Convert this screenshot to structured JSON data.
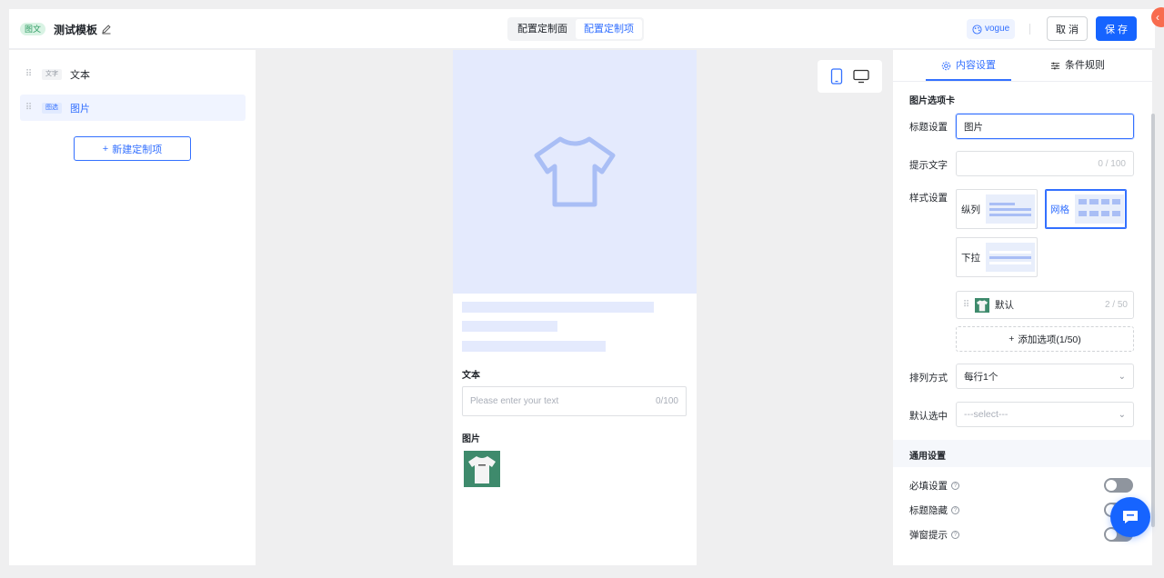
{
  "header": {
    "type_tag": "图文",
    "title": "测试模板",
    "segments": [
      "配置定制面",
      "配置定制项"
    ],
    "active_segment": "配置定制项",
    "theme": "vogue",
    "cancel_label": "取 消",
    "save_label": "保 存"
  },
  "sidebar": {
    "items": [
      {
        "tag": "文字",
        "label": "文本",
        "selected": false
      },
      {
        "tag": "图选",
        "label": "图片",
        "selected": true
      }
    ],
    "new_button": "新建定制项"
  },
  "preview": {
    "text_label": "文本",
    "input_placeholder": "Please enter your text",
    "input_counter": "0/100",
    "image_label": "图片"
  },
  "settings": {
    "tabs": [
      "内容设置",
      "条件规则"
    ],
    "active_tab": "内容设置",
    "section_title": "图片选项卡",
    "title_label": "标题设置",
    "title_value": "图片",
    "hint_label": "提示文字",
    "hint_counter": "0 / 100",
    "style_label": "样式设置",
    "styles": [
      "纵列",
      "网格",
      "下拉"
    ],
    "selected_style": "网格",
    "option_name": "默认",
    "option_counter": "2 / 50",
    "add_option": "添加选项(1/50)",
    "arrange_label": "排列方式",
    "arrange_value": "每行1个",
    "default_label": "默认选中",
    "default_placeholder": "---select---",
    "general_title": "通用设置",
    "switches": [
      {
        "label": "必填设置",
        "on": false
      },
      {
        "label": "标题隐藏",
        "on": false
      },
      {
        "label": "弹窗提示",
        "on": false
      }
    ]
  },
  "colors": {
    "accent": "#1664ff",
    "light_accent": "#e4eafd",
    "tag_green": "#2e9b62"
  }
}
